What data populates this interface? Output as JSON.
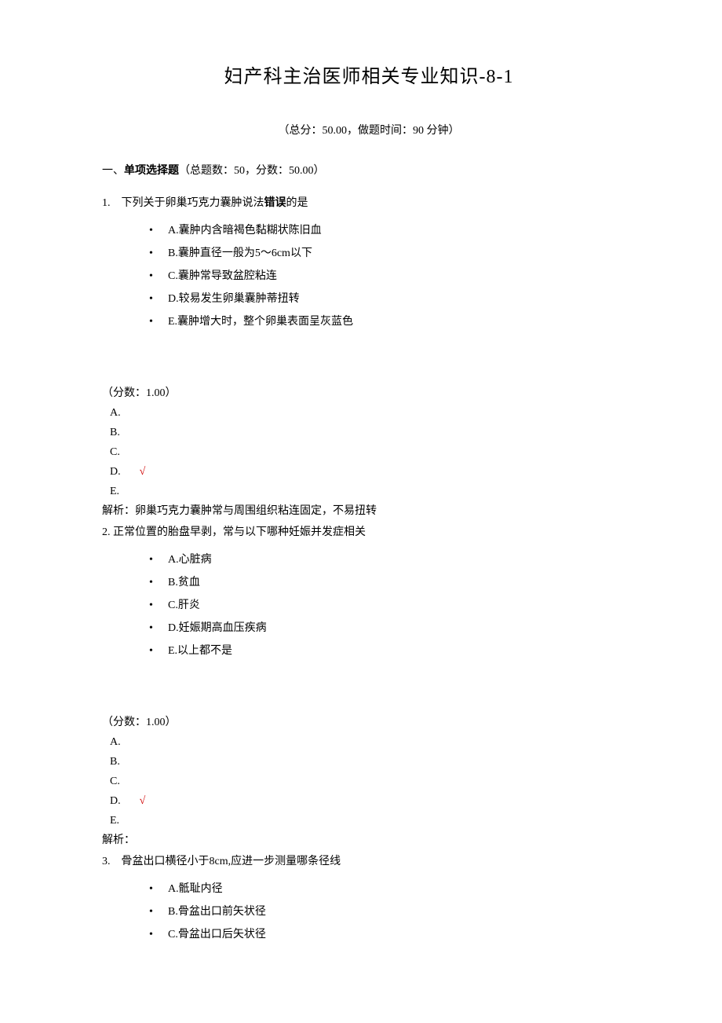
{
  "title": "妇产科主治医师相关专业知识-8-1",
  "subhead": "（总分：50.00，做题时间：90 分钟）",
  "section": {
    "label_prefix": "一、",
    "label_bold": "单项选择题",
    "label_suffix": "（总题数：50，分数：50.00）"
  },
  "score_label": "（分数：1.00）",
  "check_mark": "√",
  "analysis_prefix": "解析：",
  "answer_letters": [
    "A.",
    "B.",
    "C.",
    "D.",
    "E."
  ],
  "questions": [
    {
      "num": "1.",
      "stem_before": "下列关于卵巢巧克力囊肿说法",
      "stem_bold": "错误",
      "stem_after": "的是",
      "options": [
        "A.囊肿内含暗褐色黏糊状陈旧血",
        "B.囊肿直径一般为5～6cm以下",
        "C.囊肿常导致盆腔粘连",
        "D.较易发生卵巢囊肿蒂扭转",
        "E.囊肿增大时，整个卵巢表面呈灰蓝色"
      ],
      "correct_index": 3,
      "analysis": "卵巢巧克力囊肿常与周围组织粘连固定，不易扭转"
    },
    {
      "num": "2.",
      "stem_before": "正常位置的胎盘早剥，常与以下哪种妊娠并发症相关",
      "stem_bold": "",
      "stem_after": "",
      "options": [
        "A.心脏病",
        "B.贫血",
        "C.肝炎",
        "D.妊娠期高血压疾病",
        "E.以上都不是"
      ],
      "correct_index": 3,
      "analysis": ""
    },
    {
      "num": "3.",
      "stem_before": "骨盆出口横径小于8cm,应进一步测量哪条径线",
      "stem_bold": "",
      "stem_after": "",
      "options": [
        "A.骶耻内径",
        "B.骨盆出口前矢状径",
        "C.骨盆出口后矢状径"
      ],
      "correct_index": null,
      "analysis": null,
      "partial": true
    }
  ]
}
